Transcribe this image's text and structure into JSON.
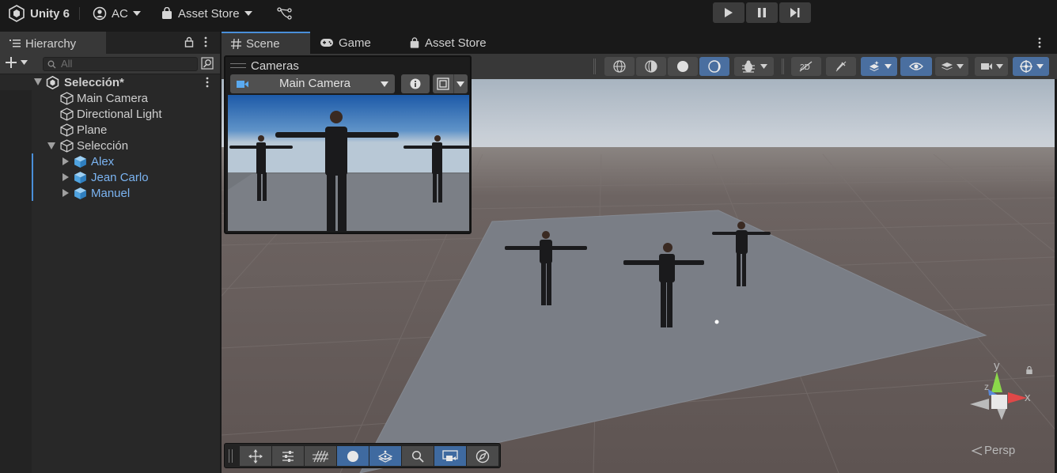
{
  "toolbar": {
    "product": "Unity 6",
    "account": "AC",
    "asset_store": "Asset Store"
  },
  "hierarchy": {
    "tab_label": "Hierarchy",
    "search_placeholder": "All",
    "scene_name": "Selección*",
    "items": [
      {
        "label": "Main Camera"
      },
      {
        "label": "Directional Light"
      },
      {
        "label": "Plane"
      },
      {
        "label": "Selección"
      },
      {
        "label": "Alex"
      },
      {
        "label": "Jean Carlo"
      },
      {
        "label": "Manuel"
      }
    ]
  },
  "scene_tabs": {
    "scene": "Scene",
    "game": "Game",
    "asset_store": "Asset Store"
  },
  "camera_overlay": {
    "title": "Cameras",
    "selected_camera": "Main Camera"
  },
  "gizmo": {
    "x": "x",
    "y": "y",
    "z": "z",
    "projection": "Persp"
  },
  "colors": {
    "accent": "#4a8fd9",
    "prefab_text": "#7bb4f2",
    "ground": "#6e6463",
    "plane": "#7a7e86",
    "sky": "#c7ced6"
  }
}
